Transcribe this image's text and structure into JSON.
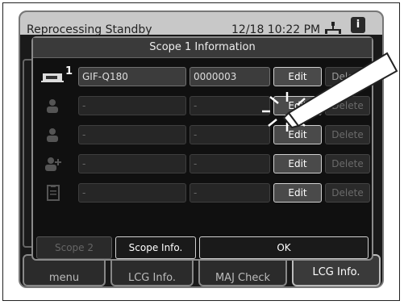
{
  "status_bar": {
    "title": "Reprocessing Standby",
    "datetime": "12/18 10:22 PM"
  },
  "background_tabs": [
    "menu",
    "LCG Info.",
    "MAJ Check",
    "LCG Info."
  ],
  "dialog": {
    "title": "Scope 1 Information",
    "rows": [
      {
        "icon": "scope-icon",
        "index": "1",
        "model": "GIF-Q180",
        "serial": "0000003",
        "edit": "Edit",
        "delete": "Delete"
      },
      {
        "icon": "operator-icon",
        "model": "-",
        "serial": "-",
        "edit": "Edit",
        "delete": "Delete"
      },
      {
        "icon": "patient-icon",
        "model": "-",
        "serial": "-",
        "edit": "Edit",
        "delete": "Delete"
      },
      {
        "icon": "doctor-icon",
        "model": "-",
        "serial": "-",
        "edit": "Edit",
        "delete": "Delete"
      },
      {
        "icon": "clipboard-icon",
        "model": "-",
        "serial": "-",
        "edit": "Edit",
        "delete": "Delete"
      }
    ],
    "buttons": {
      "scope2": "Scope 2",
      "scope_info": "Scope Info.",
      "ok": "OK"
    }
  },
  "colors": {
    "screen_bg": "#1a1a1a",
    "status_bar": "#c8c8c8",
    "button_border": "#cfcfcf"
  }
}
